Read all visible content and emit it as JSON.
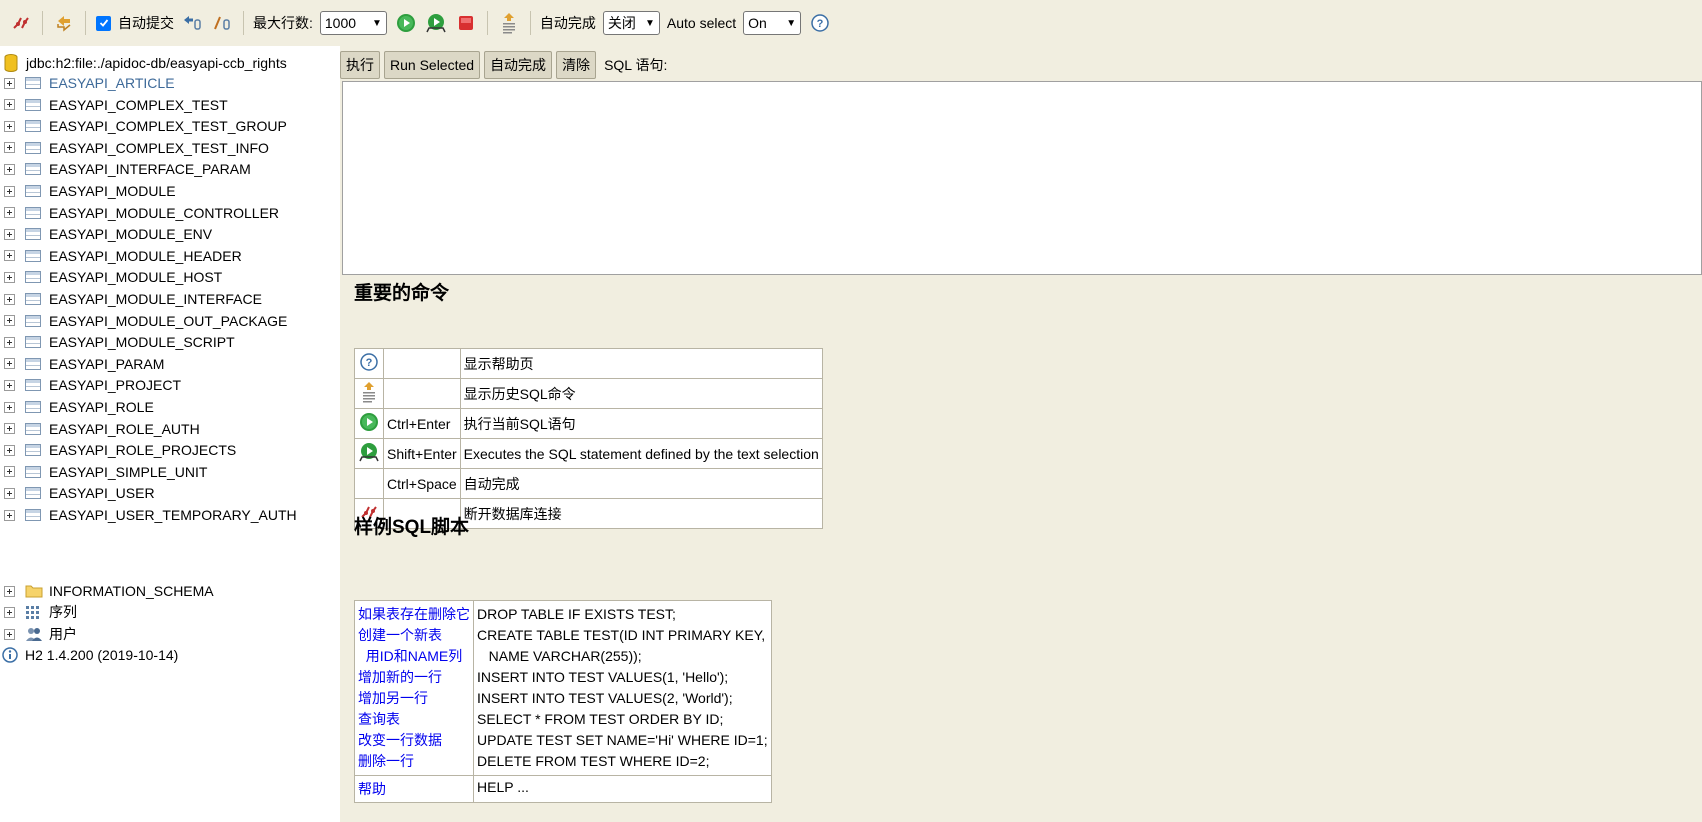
{
  "toolbar": {
    "autocommit_label": "自动提交",
    "autocommit_checked": true,
    "max_rows_label": "最大行数:",
    "max_rows_value": "1000",
    "autocomplete_label": "自动完成",
    "autocomplete_value": "关闭",
    "autoselect_label": "Auto select",
    "autoselect_value": "On"
  },
  "sidebar": {
    "connection": "jdbc:h2:file:./apidoc-db/easyapi-ccb_rights",
    "tables": [
      "EASYAPI_ARTICLE",
      "EASYAPI_COMPLEX_TEST",
      "EASYAPI_COMPLEX_TEST_GROUP",
      "EASYAPI_COMPLEX_TEST_INFO",
      "EASYAPI_INTERFACE_PARAM",
      "EASYAPI_MODULE",
      "EASYAPI_MODULE_CONTROLLER",
      "EASYAPI_MODULE_ENV",
      "EASYAPI_MODULE_HEADER",
      "EASYAPI_MODULE_HOST",
      "EASYAPI_MODULE_INTERFACE",
      "EASYAPI_MODULE_OUT_PACKAGE",
      "EASYAPI_MODULE_SCRIPT",
      "EASYAPI_PARAM",
      "EASYAPI_PROJECT",
      "EASYAPI_ROLE",
      "EASYAPI_ROLE_AUTH",
      "EASYAPI_ROLE_PROJECTS",
      "EASYAPI_SIMPLE_UNIT",
      "EASYAPI_USER",
      "EASYAPI_USER_TEMPORARY_AUTH"
    ],
    "schema": "INFORMATION_SCHEMA",
    "sequences": "序列",
    "users": "用户",
    "version": "H2 1.4.200 (2019-10-14)"
  },
  "main": {
    "buttons": {
      "execute": "执行",
      "run_selected": "Run Selected",
      "autocomplete": "自动完成",
      "clear": "清除"
    },
    "sql_label": "SQL 语句:",
    "important_title": "重要的命令",
    "commands": [
      {
        "icon": "help-icon",
        "key": "",
        "desc": "显示帮助页"
      },
      {
        "icon": "history-icon",
        "key": "",
        "desc": "显示历史SQL命令"
      },
      {
        "icon": "run-icon",
        "key": "Ctrl+Enter",
        "desc": "执行当前SQL语句"
      },
      {
        "icon": "run-selected-icon",
        "key": "Shift+Enter",
        "desc": "Executes the SQL statement defined by the text selection"
      },
      {
        "icon": "",
        "key": "Ctrl+Space",
        "desc": "自动完成"
      },
      {
        "icon": "disconnect-icon",
        "key": "",
        "desc": "断开数据库连接"
      }
    ],
    "sample_title": "样例SQL脚本",
    "samples_desc": [
      "如果表存在删除它",
      "创建一个新表",
      "  用ID和NAME列",
      "增加新的一行",
      "增加另一行",
      "查询表",
      "改变一行数据",
      "删除一行"
    ],
    "samples_sql": [
      "DROP TABLE IF EXISTS TEST;",
      "CREATE TABLE TEST(ID INT PRIMARY KEY,",
      "   NAME VARCHAR(255));",
      "INSERT INTO TEST VALUES(1, 'Hello');",
      "INSERT INTO TEST VALUES(2, 'World');",
      "SELECT * FROM TEST ORDER BY ID;",
      "UPDATE TEST SET NAME='Hi' WHERE ID=1;",
      "DELETE FROM TEST WHERE ID=2;"
    ],
    "help_desc": "帮助",
    "help_sql": "HELP ..."
  }
}
